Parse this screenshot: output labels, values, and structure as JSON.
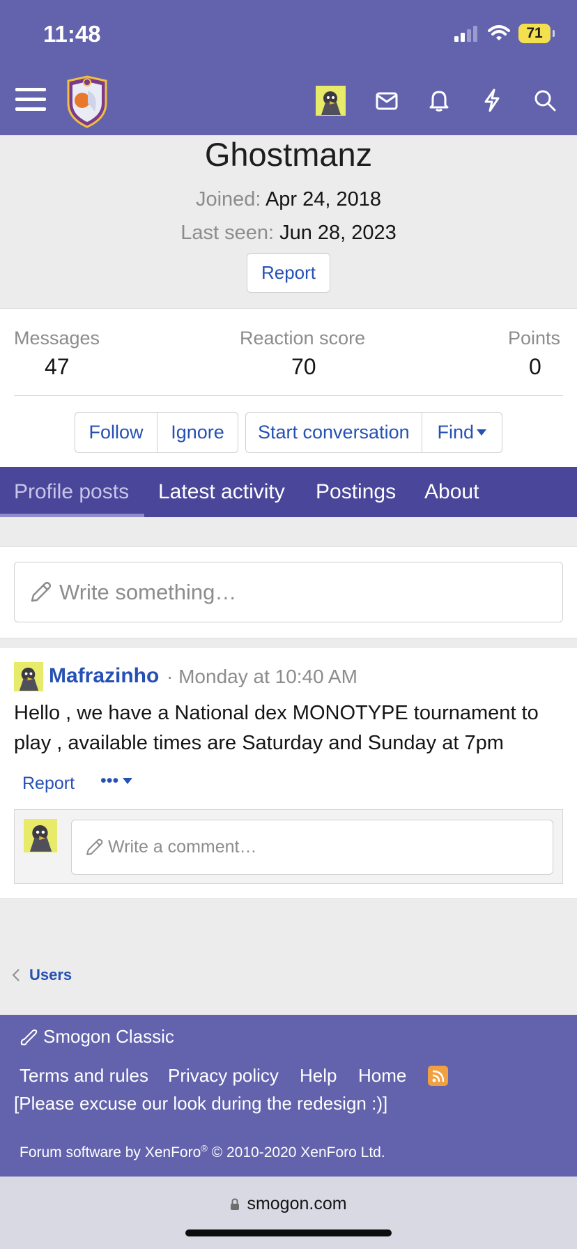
{
  "status_bar": {
    "time": "11:48",
    "battery": "71"
  },
  "header": {
    "icons": [
      "menu-icon",
      "site-logo",
      "user-avatar",
      "mail-icon",
      "bell-icon",
      "lightning-icon",
      "search-icon"
    ]
  },
  "profile": {
    "username": "Ghostmanz",
    "joined_label": "Joined:",
    "joined_value": "Apr 24, 2018",
    "last_seen_label": "Last seen:",
    "last_seen_value": "Jun 28, 2023",
    "report_label": "Report"
  },
  "stats": [
    {
      "label": "Messages",
      "value": "47"
    },
    {
      "label": "Reaction score",
      "value": "70"
    },
    {
      "label": "Points",
      "value": "0"
    }
  ],
  "actions": {
    "follow": "Follow",
    "ignore": "Ignore",
    "start_conversation": "Start conversation",
    "find": "Find"
  },
  "tabs": [
    "Profile posts",
    "Latest activity",
    "Postings",
    "About"
  ],
  "composer": {
    "placeholder": "Write something…"
  },
  "post": {
    "author": "Mafrazinho",
    "time": "· Monday at 10:40 AM",
    "body": "Hello , we have a National dex MONOTYPE tournament to play , available times are Saturday and Sunday at 7pm",
    "report_label": "Report",
    "more_label": "•••",
    "comment_placeholder": "Write a comment…"
  },
  "breadcrumb": {
    "label": "Users"
  },
  "footer": {
    "title": "Smogon Classic",
    "links": [
      "Terms and rules",
      "Privacy policy",
      "Help",
      "Home"
    ],
    "note": "[Please excuse our look during the redesign :)]",
    "copyright_prefix": "Forum software by XenForo",
    "copyright_reg": "®",
    "copyright_suffix": " © 2010-2020 XenForo Ltd."
  },
  "browser": {
    "url": "smogon.com"
  },
  "colors": {
    "brand": "#6262ad",
    "tabbar": "#4a469a",
    "link": "#2550b4"
  }
}
